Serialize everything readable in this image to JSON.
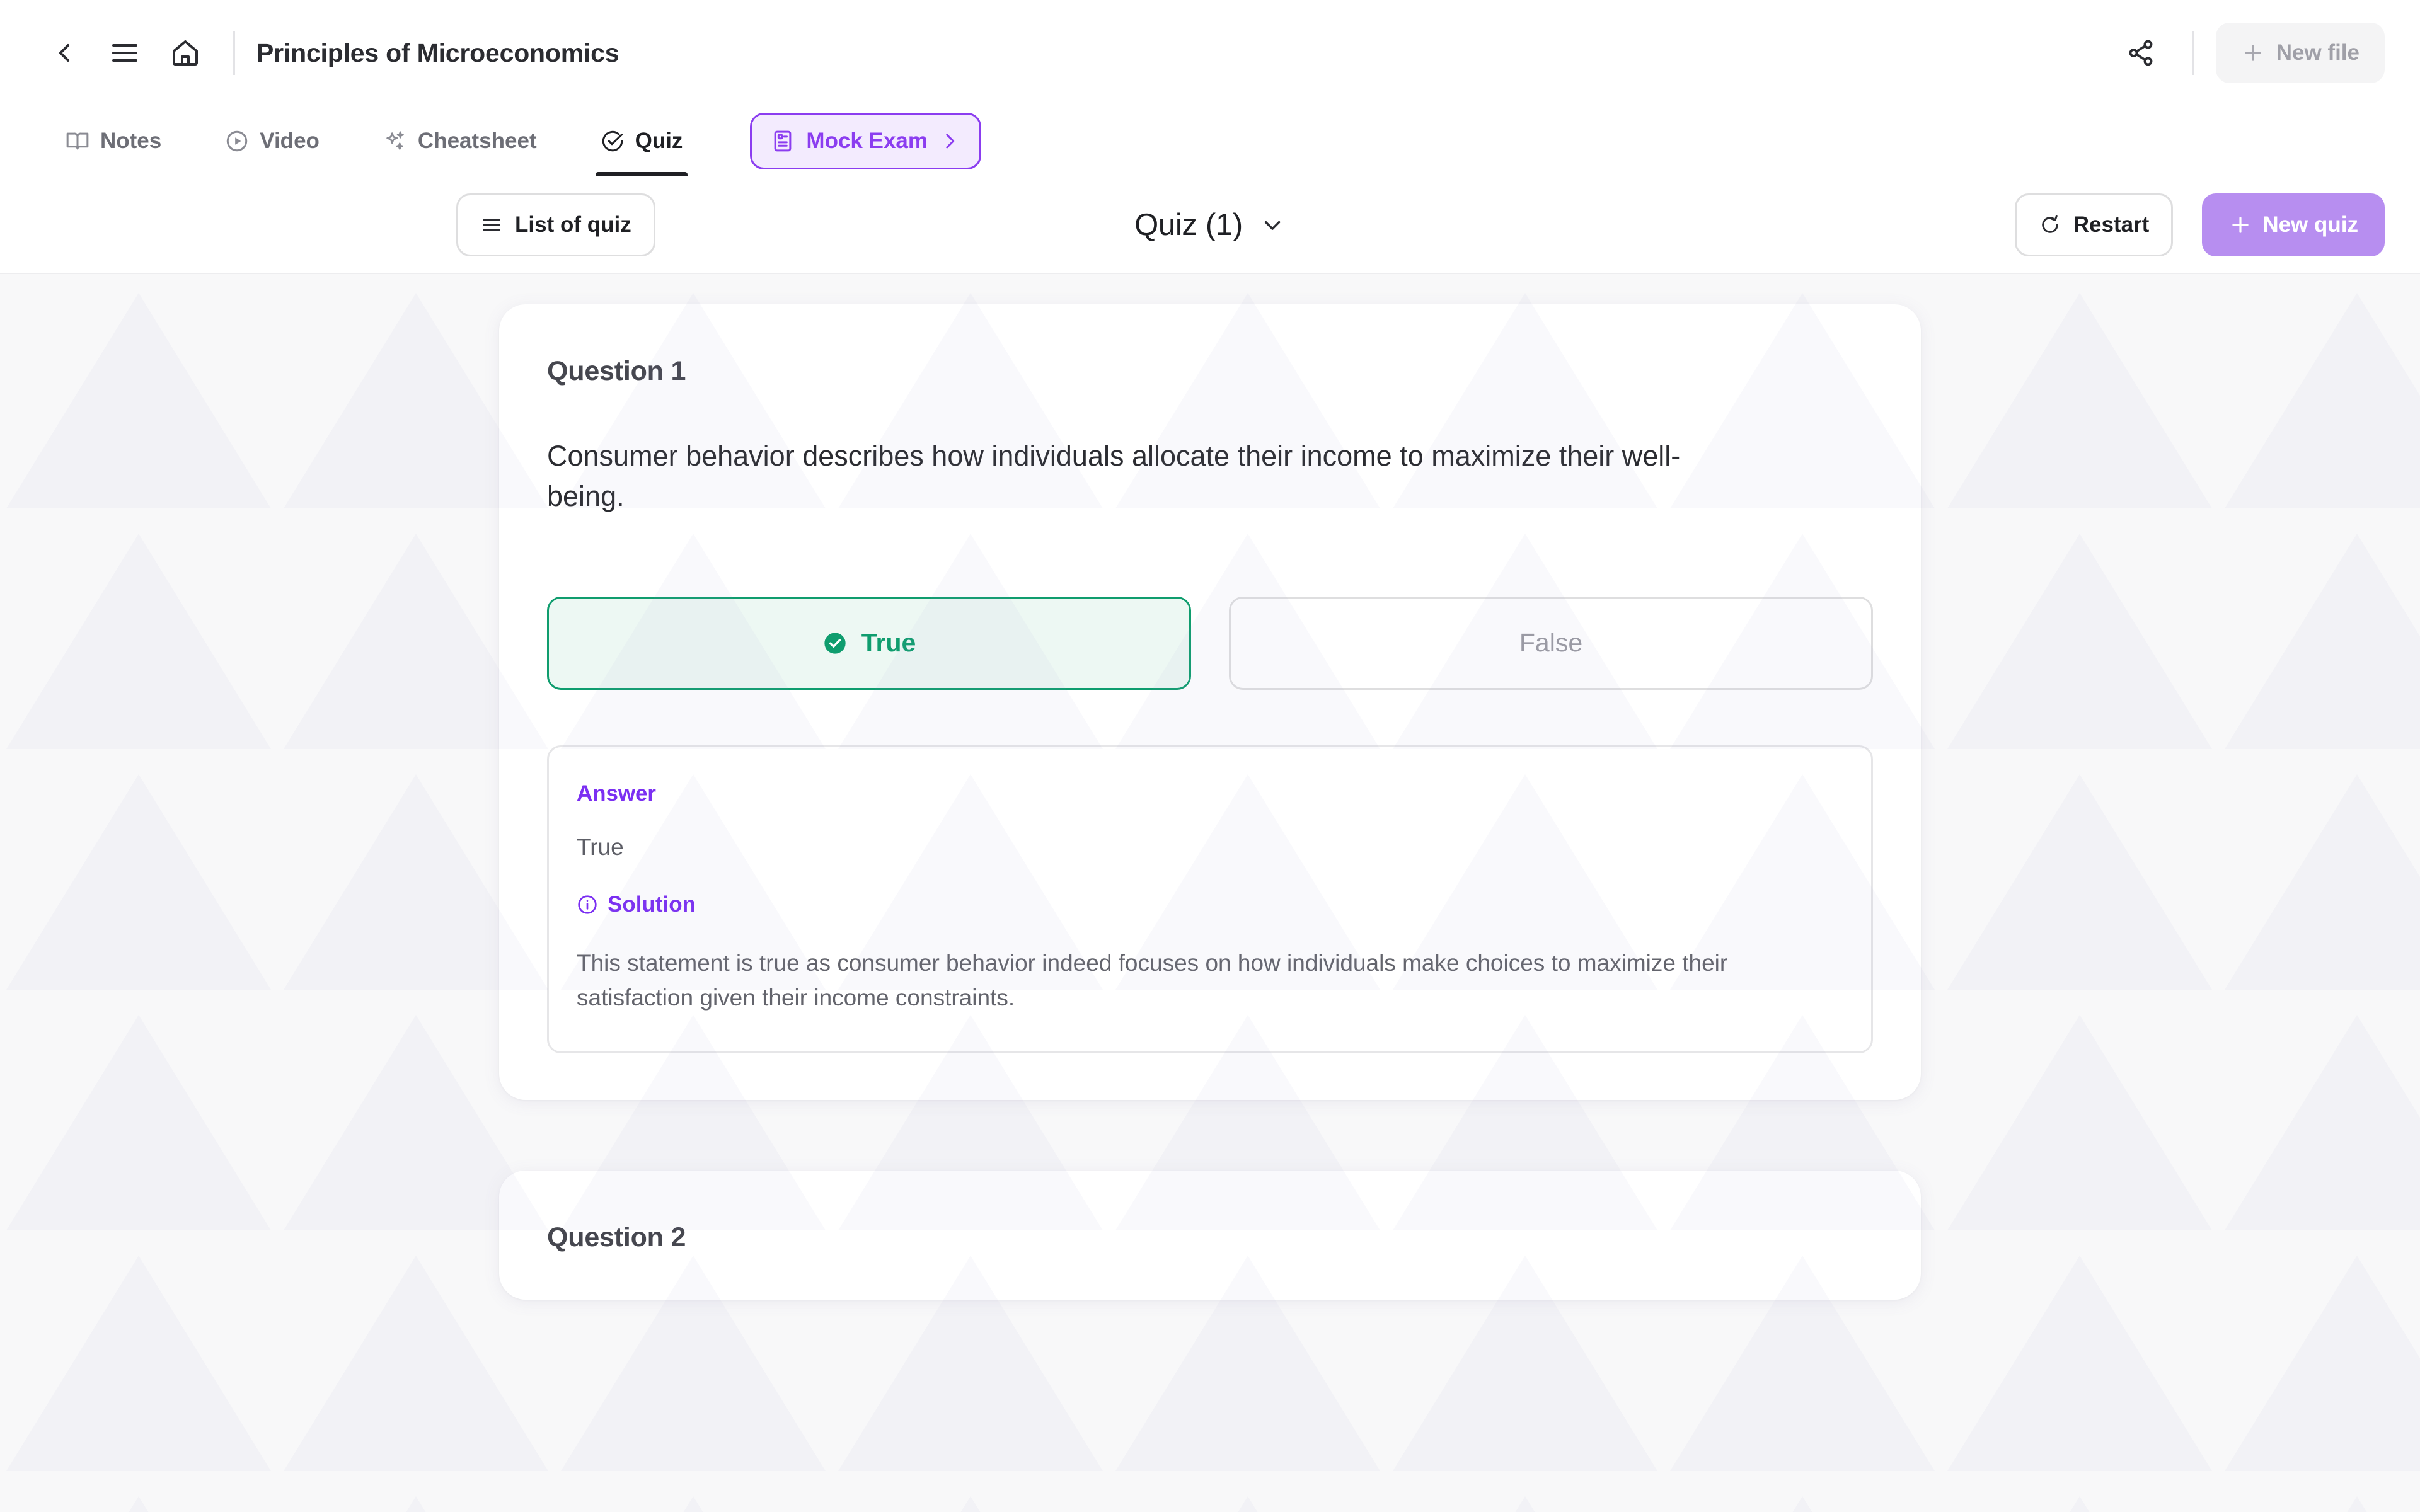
{
  "topbar": {
    "back_icon": "chevron-left-icon",
    "menu_icon": "hamburger-menu-icon",
    "home_icon": "home-icon",
    "title": "Principles of Microeconomics",
    "share_icon": "share-icon",
    "new_file_label": "New file",
    "new_file_icon": "plus-icon"
  },
  "tabs": [
    {
      "label": "Notes",
      "icon": "book-open-icon",
      "active": false
    },
    {
      "label": "Video",
      "icon": "play-circle-icon",
      "active": false
    },
    {
      "label": "Cheatsheet",
      "icon": "sparkles-icon",
      "active": false
    },
    {
      "label": "Quiz",
      "icon": "check-circle-icon",
      "active": true
    }
  ],
  "mock_exam": {
    "label": "Mock Exam",
    "icon": "exam-paper-icon",
    "chevron": "chevron-right-icon",
    "accent": "#8b3df0",
    "background": "#f3ebfe"
  },
  "toolbar": {
    "list_of_quiz_label": "List of quiz",
    "list_icon": "list-icon",
    "quiz_title": "Quiz (1)",
    "quiz_title_chevron": "chevron-down-icon",
    "restart_label": "Restart",
    "restart_icon": "refresh-icon",
    "new_quiz_label": "New quiz",
    "new_quiz_icon": "plus-icon",
    "new_quiz_color": "#b78ef0"
  },
  "questions": [
    {
      "heading": "Question 1",
      "text": "Consumer behavior describes how individuals allocate their income to maximize their well-being.",
      "choices": [
        {
          "label": "True",
          "selected": true,
          "icon": "check-filled-icon"
        },
        {
          "label": "False",
          "selected": false,
          "icon": ""
        }
      ],
      "answer_label": "Answer",
      "answer_value": "True",
      "solution_label": "Solution",
      "solution_icon": "info-circle-icon",
      "solution_text": "This statement is true as consumer behavior indeed focuses on how individuals make choices to maximize their satisfaction given their income constraints.",
      "accent_correct": "#0f9d6e",
      "accent_answer": "#7b2ff2"
    },
    {
      "heading": "Question 2"
    }
  ]
}
